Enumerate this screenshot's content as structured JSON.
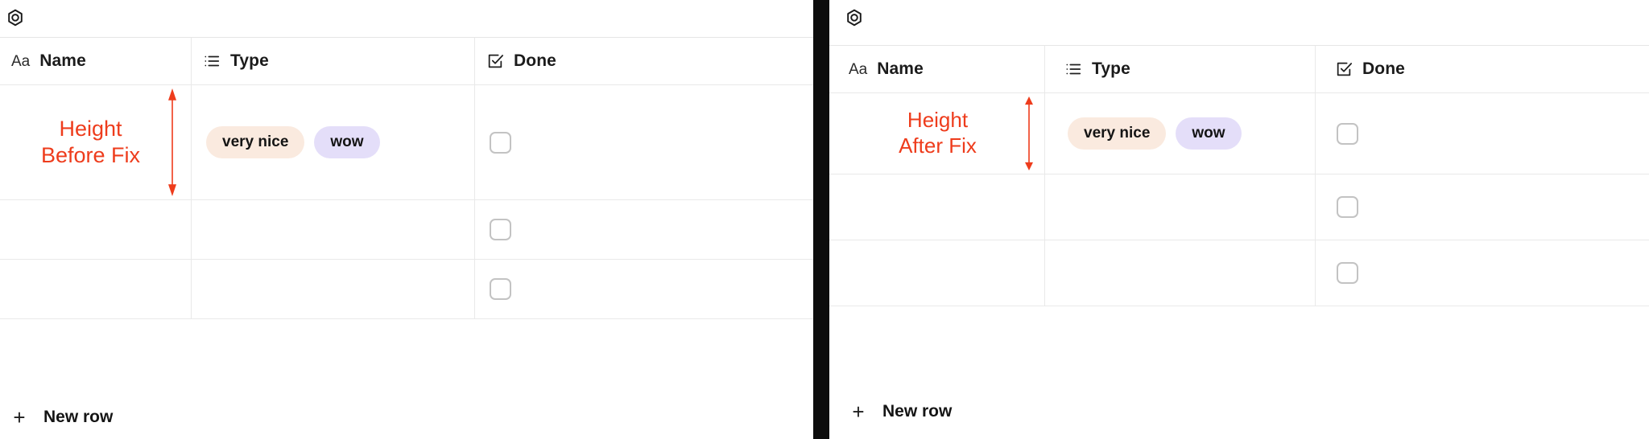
{
  "accent": {
    "annotation_red": "#EE3C1C",
    "divider_black": "#0D0D0D",
    "grid_line": "#E9E9E9",
    "checkbox_border": "#C3C3C3"
  },
  "panels": [
    {
      "id": "before",
      "app_icon": "hexagon-nut-icon",
      "annotation": "Height\nBefore Fix",
      "arrow": "double-headed-vertical-arrow",
      "columns": [
        {
          "icon": "aa-text-icon",
          "label": "Name"
        },
        {
          "icon": "list-icon",
          "label": "Type"
        },
        {
          "icon": "checkbox-check-icon",
          "label": "Done"
        }
      ],
      "rows": [
        {
          "name": "",
          "tags": [
            {
              "label": "very nice",
              "bg": "#FAEADF",
              "fg": "#141414"
            },
            {
              "label": "wow",
              "bg": "#E4DEF9",
              "fg": "#141414"
            }
          ],
          "done": false
        },
        {
          "name": "",
          "tags": [],
          "done": false
        },
        {
          "name": "",
          "tags": [],
          "done": false
        }
      ],
      "footer": {
        "icon": "plus-icon",
        "label": "New row"
      }
    },
    {
      "id": "after",
      "app_icon": "hexagon-nut-icon",
      "annotation": "Height\nAfter Fix",
      "arrow": "double-headed-vertical-arrow",
      "columns": [
        {
          "icon": "aa-text-icon",
          "label": "Name"
        },
        {
          "icon": "list-icon",
          "label": "Type"
        },
        {
          "icon": "checkbox-check-icon",
          "label": "Done"
        }
      ],
      "rows": [
        {
          "name": "",
          "tags": [
            {
              "label": "very nice",
              "bg": "#FAEADF",
              "fg": "#141414"
            },
            {
              "label": "wow",
              "bg": "#E4DEF9",
              "fg": "#141414"
            }
          ],
          "done": false
        },
        {
          "name": "",
          "tags": [],
          "done": false
        },
        {
          "name": "",
          "tags": [],
          "done": false
        }
      ],
      "footer": {
        "icon": "plus-icon",
        "label": "New row"
      }
    }
  ],
  "glyphs": {
    "aa": "Aa",
    "plus": "+"
  }
}
